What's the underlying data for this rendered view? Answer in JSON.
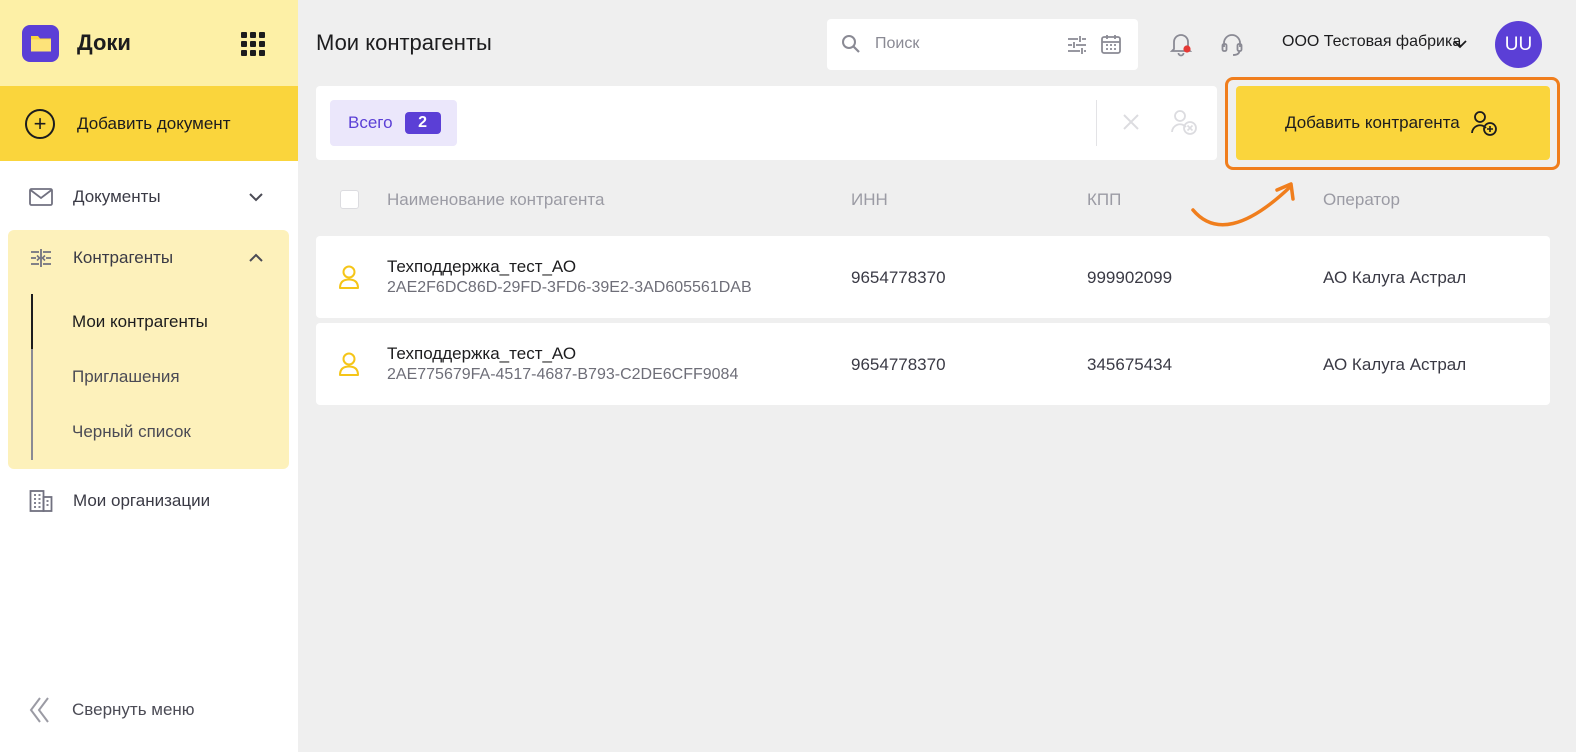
{
  "app": {
    "name": "Доки"
  },
  "sidebar": {
    "add_document": "Добавить документ",
    "items": [
      {
        "label": "Документы"
      },
      {
        "label": "Контрагенты"
      },
      {
        "label": "Мои организации"
      }
    ],
    "sub_items": [
      {
        "label": "Мои контрагенты"
      },
      {
        "label": "Приглашения"
      },
      {
        "label": "Черный список"
      }
    ],
    "collapse": "Свернуть меню"
  },
  "header": {
    "title": "Мои контрагенты",
    "search_placeholder": "Поиск",
    "org_name": "ООО Тестовая фабрика",
    "avatar_initials": "UU"
  },
  "filter": {
    "total_label": "Всего",
    "total_count": "2"
  },
  "actions": {
    "add_counterparty": "Добавить контрагента"
  },
  "table": {
    "columns": [
      "Наименование контрагента",
      "ИНН",
      "КПП",
      "Оператор"
    ],
    "rows": [
      {
        "name": "Техподдержка_тест_АО",
        "guid": "2AE2F6DC86D-29FD-3FD6-39E2-3AD605561DAB",
        "inn": "9654778370",
        "kpp": "999902099",
        "operator": "АО Калуга Астрал"
      },
      {
        "name": "Техподдержка_тест_АО",
        "guid": "2AE775679FA-4517-4687-B793-C2DE6CFF9084",
        "inn": "9654778370",
        "kpp": "345675434",
        "operator": "АО Калуга Астрал"
      }
    ]
  },
  "colors": {
    "accent": "#5b3fd6",
    "yellow": "#fad53c",
    "highlight": "#f07e1d",
    "notification_dot": "#e53935"
  }
}
